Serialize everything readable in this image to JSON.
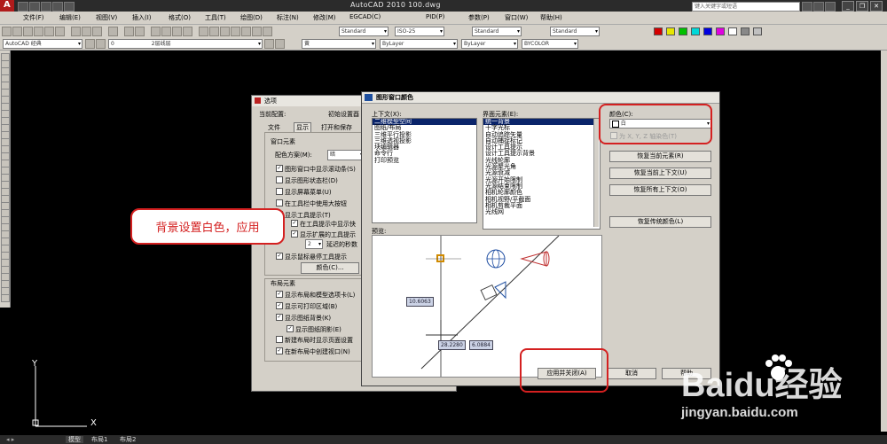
{
  "app": {
    "title": "AutoCAD 2010   100.dwg",
    "search_placeholder": "键入关键字或短语"
  },
  "menu": [
    "文件(F)",
    "编辑(E)",
    "视图(V)",
    "插入(I)",
    "格式(O)",
    "工具(T)",
    "绘图(D)",
    "标注(N)",
    "修改(M)",
    "EGCAD(C)",
    "PID(P)",
    "参数(P)",
    "窗口(W)",
    "帮助(H)"
  ],
  "toolbar": {
    "workspace": "AutoCAD 经典",
    "layer": "0",
    "text_style": "Standard",
    "dim_style": "ISO-25",
    "table_style": "Standard",
    "mleader_style": "Standard",
    "color": "黄",
    "linetype": "ByLayer",
    "lineweight": "ByLayer",
    "plotstyle": "BYCOLOR",
    "gray_label": "2层线层"
  },
  "colors": {
    "accent_red": "#d42020",
    "selection": "#0a246a",
    "dialog_bg": "#d4d0c8",
    "swatches": [
      "#d40000",
      "#e6e600",
      "#00c000",
      "#00d8d8",
      "#0000e0",
      "#e000e0",
      "#ffffff",
      "#888888",
      "#c0c0c0"
    ]
  },
  "options_dialog": {
    "title": "选项",
    "current_profile_label": "当前配置:",
    "current_profile_value": "初始设置酉",
    "tabs": [
      "文件",
      "显示",
      "打开和保存"
    ],
    "window_elements": {
      "group": "窗口元素",
      "color_scheme_label": "配色方案(M):",
      "color_scheme_value": "暗",
      "checks": [
        {
          "label": "图形窗口中显示滚动条(S)",
          "checked": true
        },
        {
          "label": "显示图形状态栏(D)",
          "checked": false
        },
        {
          "label": "显示屏幕菜单(U)",
          "checked": false
        },
        {
          "label": "在工具栏中使用大按钮",
          "checked": false
        },
        {
          "label": "显示工具提示(T)",
          "checked": true
        },
        {
          "label": "在工具提示中显示快",
          "checked": true
        },
        {
          "label": "显示扩展的工具提示",
          "checked": true
        },
        {
          "label": "显示鼠标悬停工具提示",
          "checked": true
        }
      ],
      "delay_value": "2",
      "delay_label": "延迟的秒数",
      "colors_button": "颜色(C)..."
    },
    "layout_elements": {
      "group": "布局元素",
      "checks": [
        {
          "label": "显示布局和模型选项卡(L)",
          "checked": true
        },
        {
          "label": "显示可打印区域(B)",
          "checked": true
        },
        {
          "label": "显示图纸背景(K)",
          "checked": true
        },
        {
          "label": "显示图纸阴影(E)",
          "checked": true
        },
        {
          "label": "新建布局时显示页面设置",
          "checked": false
        },
        {
          "label": "在新布局中创建视口(N)",
          "checked": true
        }
      ]
    }
  },
  "color_dialog": {
    "title": "图形窗口颜色",
    "context_label": "上下文(X):",
    "context_items": [
      "二维模型空间",
      "图纸/布局",
      "三维平行投影",
      "三维透视投影",
      "块编辑器",
      "命令行",
      "打印预览"
    ],
    "context_selected": 0,
    "interface_label": "界面元素(E):",
    "interface_items": [
      "统一背景",
      "十字光标",
      "自动追踪矢量",
      "自动捕捉标记",
      "设计工具提示",
      "设计工具提示背景",
      "光线轮廓",
      "光源聚光角",
      "光源衰减",
      "光源开始限制",
      "光源结束限制",
      "相机轮廓颜色",
      "相机视野/平截面",
      "相机剪裁平面",
      "光线网"
    ],
    "interface_selected": 0,
    "color_label": "颜色(C):",
    "color_value": "白",
    "tint_label": "为 X, Y, Z 轴染色(T)",
    "buttons": {
      "restore_current_element": "恢复当前元素(R)",
      "restore_current_context": "恢复当前上下文(U)",
      "restore_all_contexts": "恢复所有上下文(O)",
      "restore_classic_colors": "恢复传统颜色(L)",
      "apply_close": "应用并关闭(A)",
      "cancel": "取消",
      "help": "帮助"
    },
    "preview_label": "预览:",
    "preview_coords": [
      "10.6063",
      "28.2280",
      "6.0884"
    ]
  },
  "annotation": "背景设置白色，应用",
  "watermark": {
    "brand": "Baidu经验",
    "url": "jingyan.baidu.com"
  },
  "layout_tabs": [
    "模型",
    "布局1",
    "布局2"
  ],
  "ucs": {
    "x": "X",
    "y": "Y"
  }
}
